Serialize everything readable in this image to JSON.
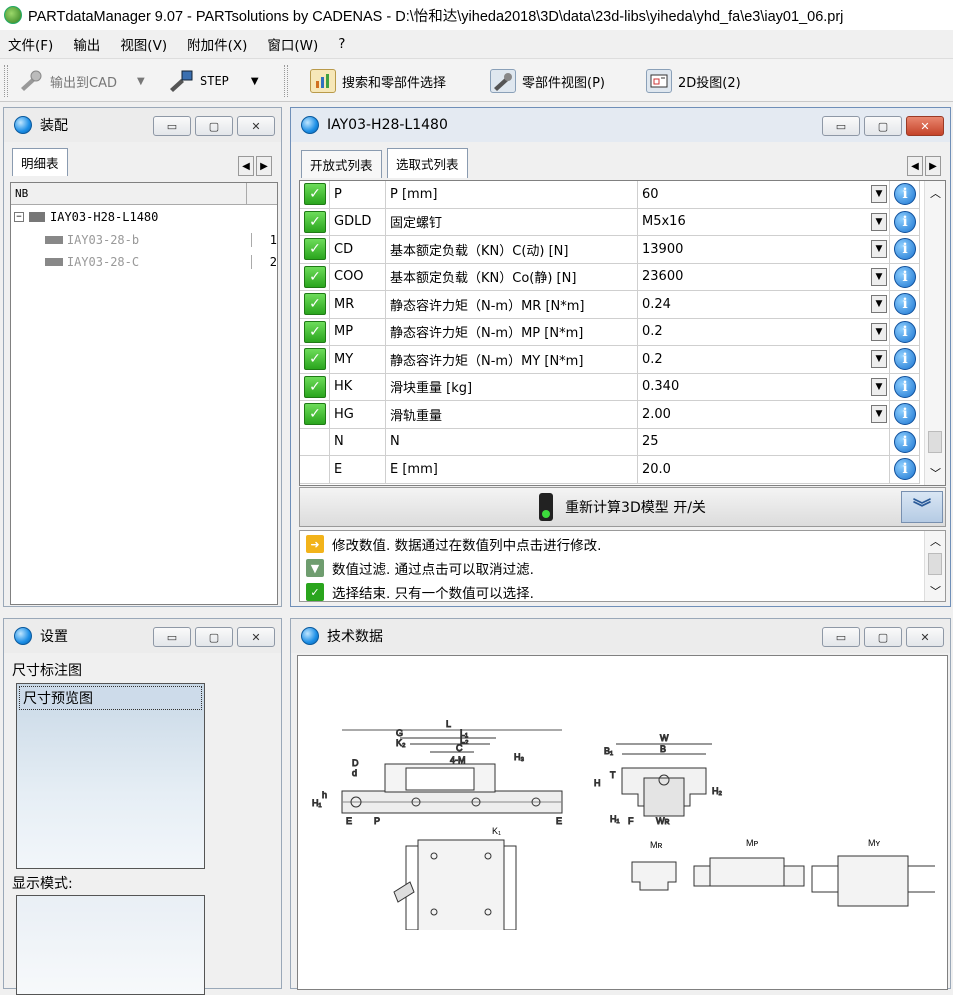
{
  "window": {
    "title": "PARTdataManager 9.07 - PARTsolutions by CADENAS - D:\\怡和达\\yiheda2018\\3D\\data\\23d-libs\\yiheda\\yhd_fa\\e3\\iay01_06.prj"
  },
  "menu": [
    "文件(F)",
    "输出",
    "视图(V)",
    "附加件(X)",
    "窗口(W)",
    "?"
  ],
  "toolbar": {
    "export_cad": "输出到CAD",
    "step": "STEP",
    "search": "搜索和零部件选择",
    "part_view": "零部件视图(P)",
    "view2d": "2D投图(2)"
  },
  "assembly": {
    "title": "装配",
    "tab": "明细表",
    "column_nb": "NB",
    "root": "IAY03-H28-L1480",
    "children": [
      {
        "name": "IAY03-28-b",
        "qty": "1"
      },
      {
        "name": "IAY03-28-C",
        "qty": "2"
      }
    ]
  },
  "part": {
    "title": "IAY03-H28-L1480",
    "tabs": [
      "开放式列表",
      "选取式列表"
    ],
    "rows": [
      {
        "key": "P",
        "desc": "P [mm]",
        "value": "60",
        "checked": true,
        "dropdown": true
      },
      {
        "key": "GDLD",
        "desc": "固定螺钉",
        "value": "M5x16",
        "checked": true,
        "dropdown": true
      },
      {
        "key": "CD",
        "desc": "基本额定负载（KN）C(动) [N]",
        "value": "13900",
        "checked": true,
        "dropdown": true
      },
      {
        "key": "COO",
        "desc": "基本额定负载（KN）Co(静) [N]",
        "value": "23600",
        "checked": true,
        "dropdown": true
      },
      {
        "key": "MR",
        "desc": "静态容许力矩（N-m）MR [N*m]",
        "value": "0.24",
        "checked": true,
        "dropdown": true
      },
      {
        "key": "MP",
        "desc": "静态容许力矩（N-m）MP [N*m]",
        "value": "0.2",
        "checked": true,
        "dropdown": true
      },
      {
        "key": "MY",
        "desc": "静态容许力矩（N-m）MY [N*m]",
        "value": "0.2",
        "checked": true,
        "dropdown": true
      },
      {
        "key": "HK",
        "desc": "滑块重量 [kg]",
        "value": "0.340",
        "checked": true,
        "dropdown": true
      },
      {
        "key": "HG",
        "desc": "滑轨重量",
        "value": "2.00",
        "checked": true,
        "dropdown": true
      },
      {
        "key": "N",
        "desc": "N",
        "value": "25",
        "checked": false,
        "dropdown": false
      },
      {
        "key": "E",
        "desc": "E [mm]",
        "value": "20.0",
        "checked": false,
        "dropdown": false
      }
    ],
    "recalc": "重新计算3D模型 开/关",
    "messages": [
      {
        "icon": "arrow",
        "text": "修改数值. 数据通过在数值列中点击进行修改."
      },
      {
        "icon": "filter",
        "text": "数值过滤. 通过点击可以取消过滤."
      },
      {
        "icon": "check",
        "text": "选择结束. 只有一个数值可以选择."
      }
    ]
  },
  "settings": {
    "title": "设置",
    "dim_label": "尺寸标注图",
    "dim_item": "尺寸预览图",
    "display_label": "显示模式:"
  },
  "techdata": {
    "title": "技术数据",
    "labels": {
      "L": "L",
      "L1": "L₁",
      "L2": "L₂",
      "G": "G",
      "K2": "K₂",
      "C": "C",
      "M": "4-M",
      "H3": "H₃",
      "D": "D",
      "d": "d",
      "h": "h",
      "H1": "H₁",
      "E": "E",
      "P": "P",
      "W": "W",
      "B": "B",
      "B1": "B₁",
      "T": "T",
      "H": "H",
      "H2": "H₂",
      "F": "F",
      "WR": "Wʀ",
      "K1": "K₁",
      "MR": "Mʀ",
      "MP": "Mᴘ",
      "MY": "Mʏ"
    }
  }
}
